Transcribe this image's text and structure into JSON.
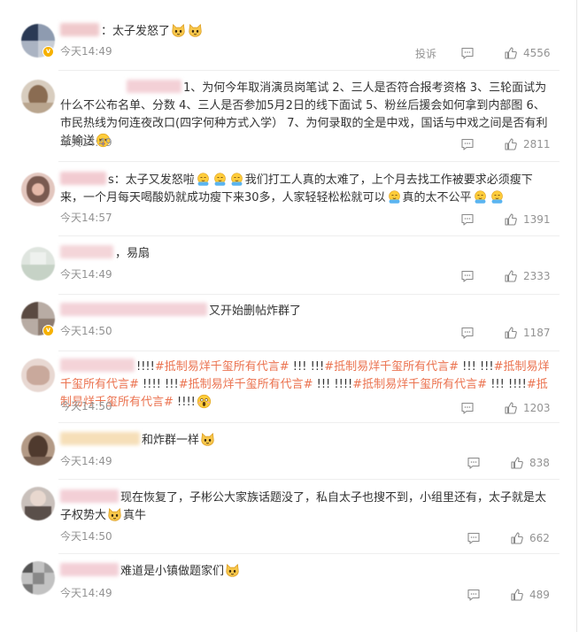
{
  "ui": {
    "time_prefix": "今天",
    "report_label": "投诉",
    "colors": {
      "hashtag": "#eb7350",
      "meta": "#939393",
      "text": "#333333",
      "badge": "#f6b100"
    }
  },
  "comments": [
    {
      "text_a": "：太子发怒了",
      "time": "今天14:49",
      "likes": "4556"
    },
    {
      "text_a": "1、为何今年取消演员岗笔试 2、三人是否符合报考资格 3、三轮面试为什么不公布名单、分数 4、三人是否参加5月2日的线下面试 5、粉丝后援会如何拿到内部图 6、市民热线为何连夜改口(四字何种方式入学） 7、为何录取的全是中戏，国话与中戏之间是否有利益输送",
      "time": "今天14:49",
      "likes": "2811"
    },
    {
      "text_a": "s：太子又发怒啦",
      "text_b": "我们打工人真的太难了，上个月去找工作被要求必须瘦下来，一个月每天喝酸奶就成功瘦下来30多，人家轻轻松松就可以",
      "text_c": "真的太不公平",
      "time": "今天14:57",
      "likes": "1391"
    },
    {
      "text_a": "，易扇",
      "time": "今天14:49",
      "likes": "2333"
    },
    {
      "text_a": "又开始删帖炸群了",
      "time": "今天14:50",
      "likes": "1187"
    },
    {
      "bang": "!!!!",
      "bang3": "!!!",
      "tag": "#抵制易烊千玺所有代言#",
      "time": "今天14:50",
      "likes": "1203"
    },
    {
      "text_a": "和炸群一样",
      "time": "今天14:49",
      "likes": "838"
    },
    {
      "text_a": "现在恢复了，子彬公大家族话题没了，私自太子也搜不到，小组里还有，太子就是太子权势大",
      "text_b": "真牛",
      "time": "今天14:50",
      "likes": "662"
    },
    {
      "text_a": "难道是小镇做题家们",
      "time": "今天14:49",
      "likes": "489"
    }
  ]
}
